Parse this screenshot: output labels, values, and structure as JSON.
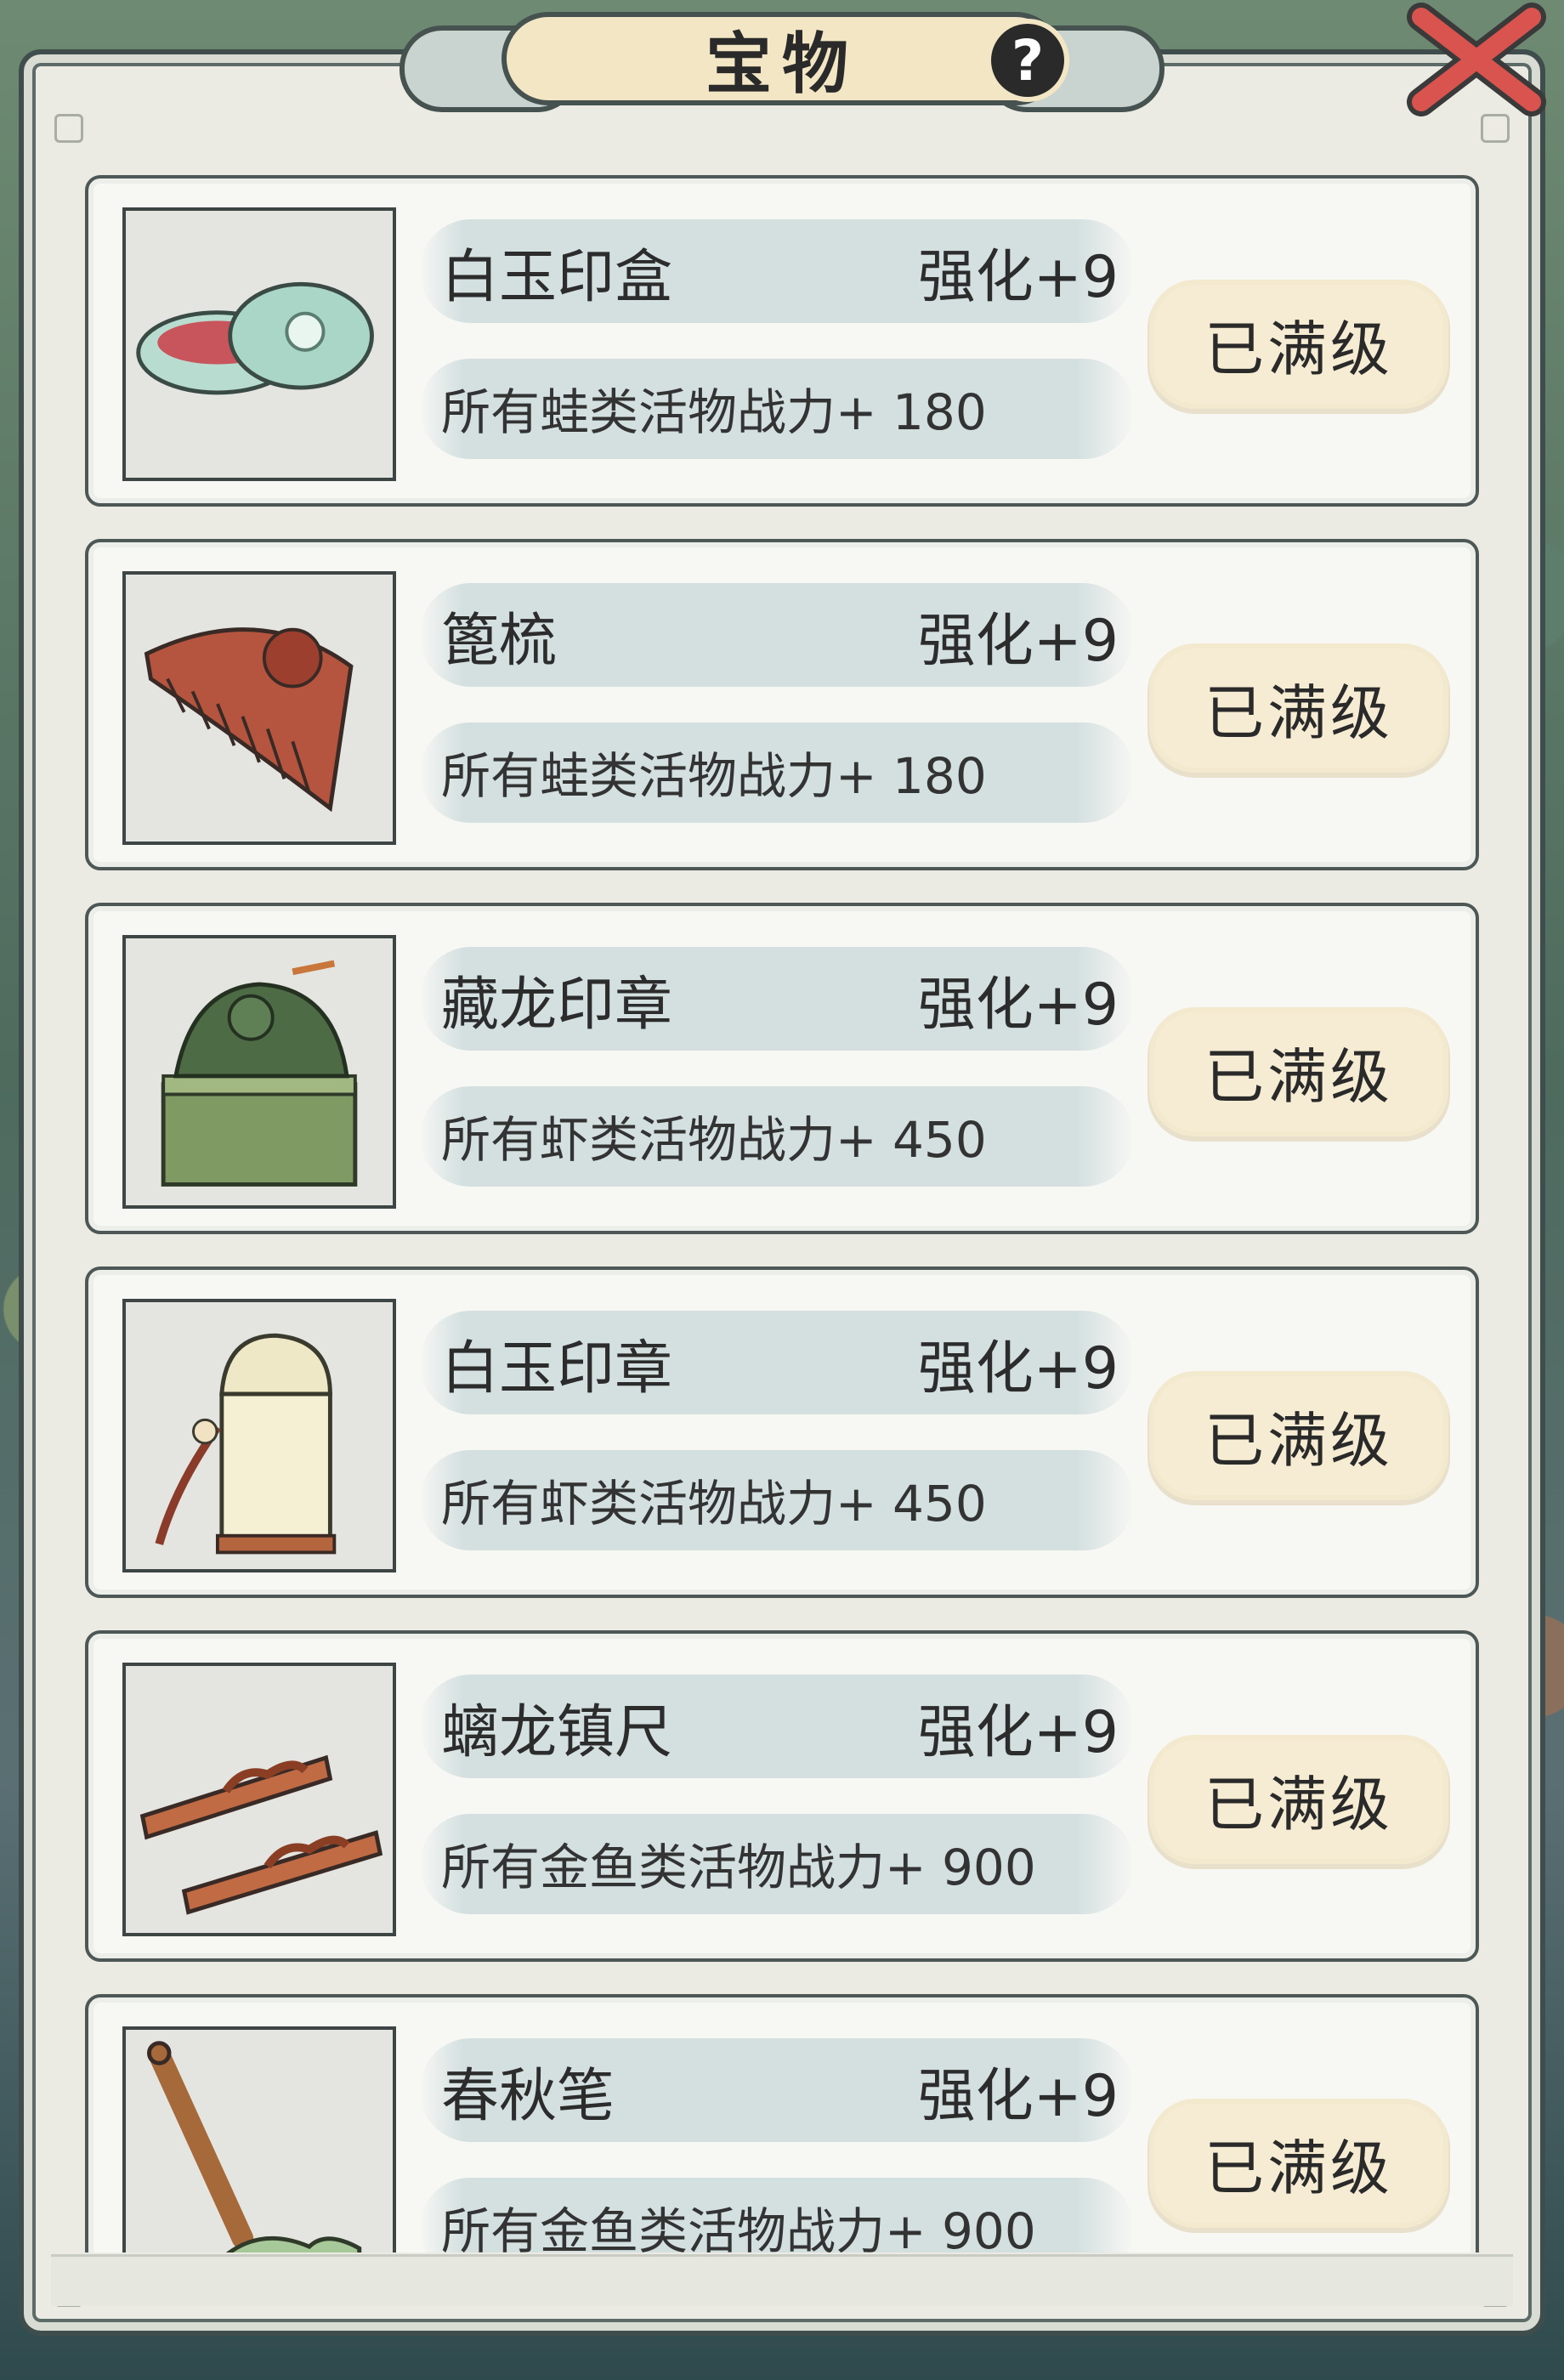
{
  "header": {
    "title": "宝物",
    "help_label": "?"
  },
  "items": [
    {
      "name": "白玉印盒",
      "level": "强化+9",
      "desc": "所有蛙类活物战力+ 180",
      "button": "已满级",
      "icon": "jade-ink-box-icon"
    },
    {
      "name": "篦梳",
      "level": "强化+9",
      "desc": "所有蛙类活物战力+ 180",
      "button": "已满级",
      "icon": "comb-icon"
    },
    {
      "name": "藏龙印章",
      "level": "强化+9",
      "desc": "所有虾类活物战力+ 450",
      "button": "已满级",
      "icon": "dragon-seal-icon"
    },
    {
      "name": "白玉印章",
      "level": "强化+9",
      "desc": "所有虾类活物战力+ 450",
      "button": "已满级",
      "icon": "jade-seal-icon"
    },
    {
      "name": "螭龙镇尺",
      "level": "强化+9",
      "desc": "所有金鱼类活物战力+ 900",
      "button": "已满级",
      "icon": "paperweight-icon"
    },
    {
      "name": "春秋笔",
      "level": "强化+9",
      "desc": "所有金鱼类活物战力+ 900",
      "button": "已满级",
      "icon": "brush-pen-icon"
    }
  ],
  "colors": {
    "panel": "#ebebe3",
    "button": "#f6ecd3",
    "bar": "#d4e0e0",
    "close": "#d9534f"
  }
}
